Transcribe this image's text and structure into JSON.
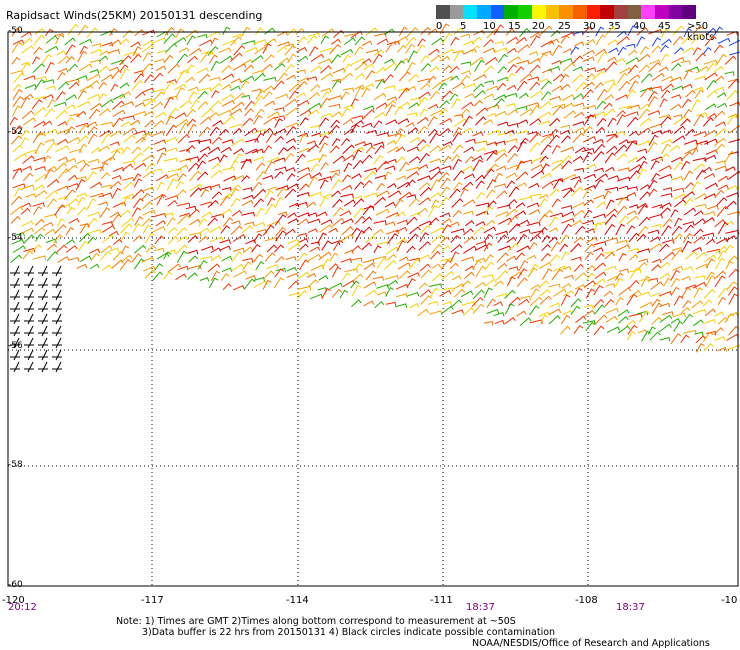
{
  "title": "Rapidsact Winds(25KM) 20150131 descending",
  "legend": {
    "labels": [
      "0",
      "5",
      "10",
      "15",
      "20",
      "25",
      "30",
      "35",
      "40",
      "45",
      ">50 knots"
    ],
    "colors": [
      "#505050",
      "#9a9a9a",
      "#00e0ff",
      "#00a8ff",
      "#1060ff",
      "#00b000",
      "#10d000",
      "#f8f800",
      "#f8c000",
      "#f89000",
      "#f86000",
      "#f82000",
      "#c00000",
      "#a04040",
      "#806040",
      "#ff40ff",
      "#c000c0",
      "#8000a0",
      "#600080"
    ]
  },
  "axes": {
    "x_ticks": [
      "-120",
      "-117",
      "-114",
      "-111",
      "-108",
      "-10"
    ],
    "y_ticks": [
      "-50",
      "-52",
      "-54",
      "-56",
      "-58",
      "-60"
    ]
  },
  "times": [
    "20:12",
    "18:37",
    "18:37"
  ],
  "notes": [
    "Note: 1) Times are GMT 2)Times along bottom correspond to measurement at ~50S",
    "3)Data buffer is 22 hrs from 20150131 4) Black circles indicate possible contamination",
    "NOAA/NESDIS/Office of Research and Applications"
  ]
}
